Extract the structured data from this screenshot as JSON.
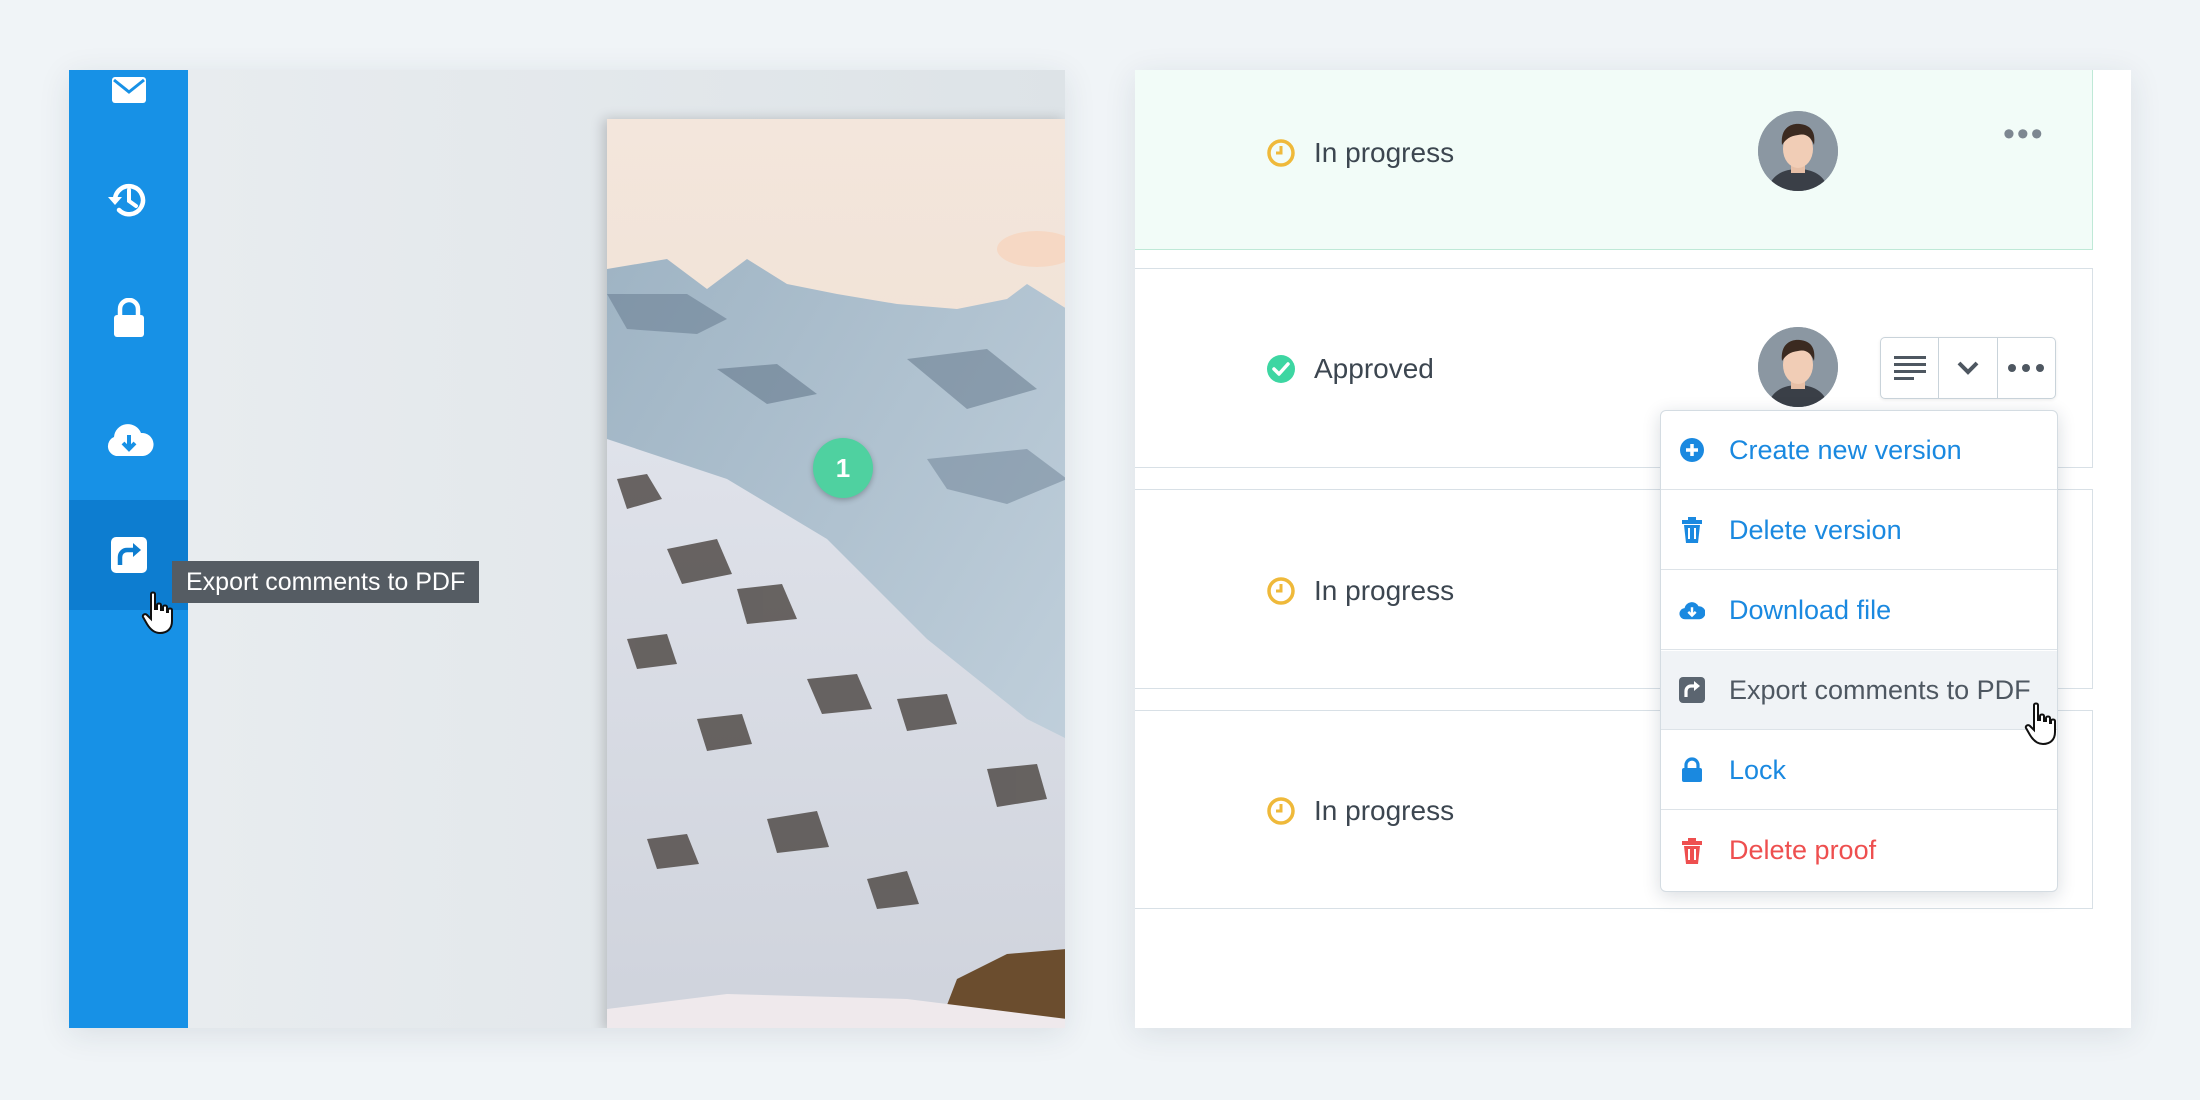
{
  "sidebar": {
    "tooltip": "Export comments to PDF",
    "icons": [
      "mail-icon",
      "history-icon",
      "lock-icon",
      "cloud-download-icon",
      "export-icon"
    ]
  },
  "canvas": {
    "marker_number": "1"
  },
  "versions": [
    {
      "status": "In progress",
      "status_icon": "clock-icon"
    },
    {
      "status": "Approved",
      "status_icon": "check-circle-icon"
    },
    {
      "status": "In progress",
      "status_icon": "clock-icon"
    },
    {
      "status": "In progress",
      "status_icon": "clock-icon"
    }
  ],
  "more_label": "•••",
  "menu": {
    "items": [
      {
        "label": "Create new version",
        "icon": "plus-circle-icon"
      },
      {
        "label": "Delete version",
        "icon": "trash-icon"
      },
      {
        "label": "Download file",
        "icon": "cloud-download-icon"
      },
      {
        "label": "Export comments to PDF",
        "icon": "export-icon"
      },
      {
        "label": "Lock",
        "icon": "lock-icon"
      },
      {
        "label": "Delete proof",
        "icon": "trash-icon"
      }
    ]
  },
  "colors": {
    "sidebar": "#1791e6",
    "accent": "#1a89e0",
    "danger": "#ee4f4f",
    "approved": "#3dd6a2",
    "in_progress": "#efb93a"
  }
}
